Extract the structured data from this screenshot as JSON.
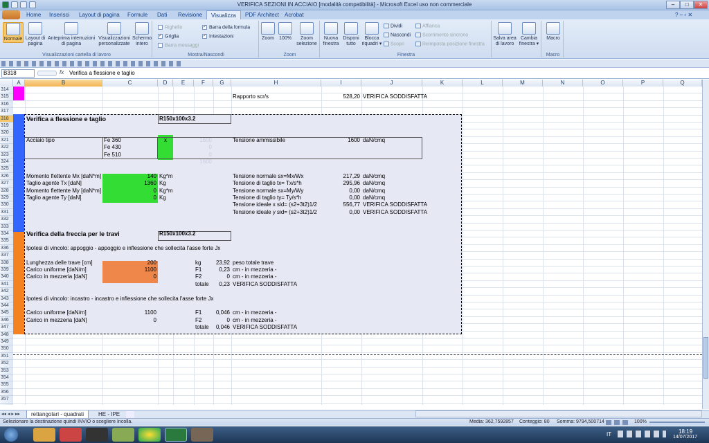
{
  "window": {
    "title": "VERIFICA SEZIONI IN ACCIAIO  [modalità compatibilità] - Microsoft Excel uso non commerciale",
    "controls": [
      "–",
      "□",
      "✕"
    ]
  },
  "ribbon_tabs": [
    "Home",
    "Inserisci",
    "Layout di pagina",
    "Formule",
    "Dati",
    "Revisione",
    "Visualizza",
    "PDF Architect",
    "Acrobat"
  ],
  "active_tab": "Visualizza",
  "ribbon": {
    "view_group": {
      "label": "Visualizzazioni cartella di lavoro",
      "buttons": [
        "Normale",
        "Layout di pagina",
        "Anteprima interruzioni di pagina",
        "Visualizzazioni personalizzate",
        "Schermo intero"
      ]
    },
    "show_group": {
      "label": "Mostra/Nascondi",
      "righello": "Righello",
      "griglia": "Griglia",
      "barra_messaggi": "Barra messaggi",
      "barra_formula": "Barra della formula",
      "intestazioni": "Intestazioni"
    },
    "zoom_group": {
      "label": "Zoom",
      "buttons": [
        "Zoom",
        "100%",
        "Zoom selezione"
      ]
    },
    "window_group": {
      "label": "Finestra",
      "buttons": [
        "Nuova finestra",
        "Disponi tutto",
        "Blocca riquadri ▾"
      ],
      "small": [
        "Dividi",
        "Nascondi",
        "Scopri",
        "Affianca",
        "Scorrimento sincrono",
        "Reimposta posizione finestra"
      ],
      "save_area": "Salva area di lavoro",
      "change_window": "Cambia finestra ▾"
    },
    "macro_group": {
      "label": "Macro",
      "button": "Macro"
    }
  },
  "formula_bar": {
    "name_box": "B318",
    "fx": "fx",
    "formula": "Verifica a flessione e taglio"
  },
  "columns": [
    "A",
    "B",
    "C",
    "D",
    "E",
    "F",
    "G",
    "H",
    "I",
    "J",
    "K",
    "L",
    "M",
    "N",
    "O",
    "P",
    "Q"
  ],
  "rows": [
    "314",
    "315",
    "316",
    "317",
    "318",
    "319",
    "320",
    "321",
    "322",
    "323",
    "324",
    "325",
    "326",
    "327",
    "328",
    "329",
    "330",
    "331",
    "332",
    "333",
    "334",
    "335",
    "336",
    "337",
    "338",
    "339",
    "340",
    "341",
    "342",
    "343",
    "344",
    "345",
    "346",
    "347",
    "348",
    "349",
    "350",
    "351",
    "352",
    "353",
    "354",
    "355",
    "356",
    "357"
  ],
  "cells": {
    "r315": {
      "h": "Rapporto scr/s",
      "i": "528,20",
      "j": "VERIFICA SODDISFATTA"
    },
    "r318": {
      "b": "Verifica a flessione e taglio",
      "d": "R150x100x3.2"
    },
    "r321": {
      "b": "Acciaio tipo",
      "c": "Fe 360",
      "d": "x",
      "f": "1600",
      "h": "Tensione ammissibile",
      "i": "1600",
      "j": "daN/cmq"
    },
    "r322": {
      "c": "Fe 430",
      "f": "0"
    },
    "r323": {
      "c": "Fe 510",
      "f": "0"
    },
    "r324": {
      "f": "1600"
    },
    "r326": {
      "b": "Momento flettente Mx  [daN*m]",
      "c": "140",
      "d": "Kg*m",
      "h": "Tensione normale sx=Mx/Wx",
      "i": "217,29",
      "j": "daN/cmq"
    },
    "r327": {
      "b": "Taglio agente Tx [daN]",
      "c": "1360",
      "d": "Kg",
      "h": "Tensione di taglio tx= Tx/s*h",
      "i": "295,96",
      "j": "daN/cmq"
    },
    "r328": {
      "b": "Momento flettente My  [daN*m]",
      "c": "0",
      "d": "Kg*m",
      "h": "Tensione normale sx=My/Wy",
      "i": "0,00",
      "j": "daN/cmq"
    },
    "r329": {
      "b": "Taglio agente Ty [daN]",
      "c": "0",
      "d": "Kg",
      "h": "Tensione di taglio ty= Ty/s*h",
      "i": "0,00",
      "j": "daN/cmq"
    },
    "r330": {
      "h": "Tensione ideale x sid= (s2+3t2)1/2",
      "i": "556,77",
      "j": "VERIFICA SODDISFATTA"
    },
    "r331": {
      "h": "Tensione ideale y sid= (s2+3t2)1/2",
      "i": "0,00",
      "j": "VERIFICA SODDISFATTA"
    },
    "r334": {
      "b": "Verifica della freccia per le travi",
      "d": "R150x100x3.2"
    },
    "r336": {
      "b": "Ipotesi di vincolo: appoggio - appoggio e inflessione che sollecita l'asse forte Jx"
    },
    "r338": {
      "b": "Lunghezza delle trave [cm]",
      "c": "200",
      "f": "kg",
      "g": "23,92",
      "h": "peso totale trave"
    },
    "r339": {
      "b": "Carico uniforme  [daN/m]",
      "c": "1100",
      "f": "F1",
      "g": "0,23",
      "h": "cm - in mezzeria -"
    },
    "r340": {
      "b": "Carico in mezzeria [daN]",
      "c": "0",
      "f": "F2",
      "g": "0",
      "h": "cm - in mezzeria -"
    },
    "r341": {
      "f": "totale",
      "g": "0,23",
      "h": "VERIFICA SODDISFATTA"
    },
    "r343": {
      "b": "Ipotesi di vincolo: incastro - incastro e inflessione che sollecita l'asse forte Jx"
    },
    "r345": {
      "b": "Carico uniforme  [daN/m]",
      "c": "1100",
      "f": "F1",
      "g": "0,046",
      "h": "cm - in mezzeria -"
    },
    "r346": {
      "b": "Carico in mezzeria [daN]",
      "c": "0",
      "f": "F2",
      "g": "0",
      "h": "cm - in mezzeria -"
    },
    "r347": {
      "f": "totale",
      "g": "0,046",
      "h": "VERIFICA SODDISFATTA"
    }
  },
  "sheet_tabs": [
    "rettangolari - quadrati",
    "HE - IPE"
  ],
  "status": {
    "message": "Selezionare la destinazione quindi INVIO o scegliere Incolla.",
    "media": "Media: 362,7592857",
    "conteggio": "Conteggio: 80",
    "somma": "Somma: 9794,500714",
    "zoom": "100%"
  },
  "taskbar": {
    "lang": "IT",
    "time": "18:19",
    "date": "14/07/2017"
  },
  "colors": {
    "magenta": "#ff00ff",
    "blue_marker": "#3366ff",
    "orange_marker": "#f58220",
    "green_input": "#33dd33",
    "orange_input": "#f0874a",
    "block_bg": "#e6e8f4"
  }
}
